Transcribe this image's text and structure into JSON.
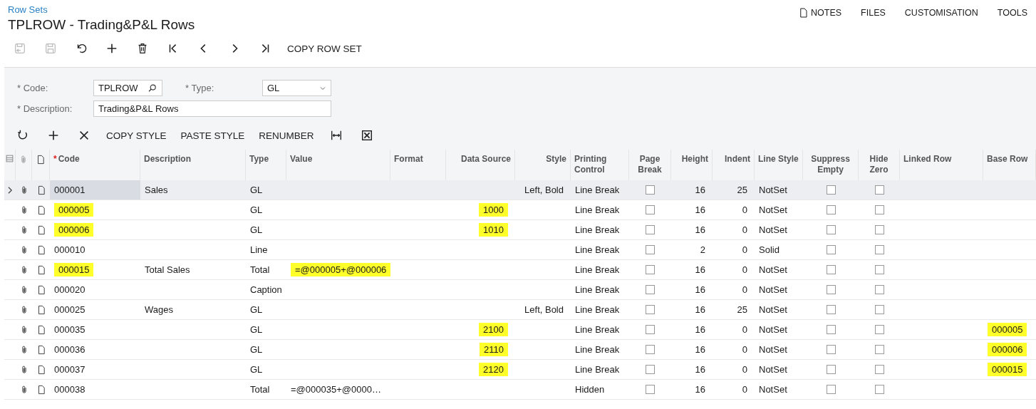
{
  "breadcrumb": "Row Sets",
  "title": "TPLROW - Trading&P&L Rows",
  "top_links": [
    {
      "kind": "note",
      "label": "NOTES"
    },
    {
      "kind": "plain",
      "label": "FILES"
    },
    {
      "kind": "plain",
      "label": "CUSTOMISATION"
    },
    {
      "kind": "plain",
      "label": "TOOLS"
    }
  ],
  "toolbar": [
    {
      "kind": "save-close",
      "disabled": true
    },
    {
      "kind": "save",
      "disabled": true
    },
    {
      "kind": "undo",
      "disabled": false
    },
    {
      "kind": "add",
      "disabled": false
    },
    {
      "kind": "delete",
      "disabled": false
    },
    {
      "kind": "first",
      "disabled": false
    },
    {
      "kind": "prev",
      "disabled": false
    },
    {
      "kind": "next",
      "disabled": false
    },
    {
      "kind": "last",
      "disabled": false
    },
    {
      "kind": "text",
      "label": "COPY ROW SET",
      "disabled": false
    }
  ],
  "form": {
    "code": {
      "mark": "*",
      "label": "Code:",
      "value": "TPLROW"
    },
    "type": {
      "mark": "*",
      "label": "Type:",
      "value": "GL"
    },
    "description": {
      "mark": "*",
      "label": "Description:",
      "value": "Trading&P&L Rows"
    }
  },
  "grid_toolbar": [
    {
      "kind": "refresh"
    },
    {
      "kind": "add"
    },
    {
      "kind": "remove"
    },
    {
      "kind": "text",
      "label": "COPY STYLE"
    },
    {
      "kind": "text",
      "label": "PASTE STYLE"
    },
    {
      "kind": "text",
      "label": "RENUMBER"
    },
    {
      "kind": "fit"
    },
    {
      "kind": "excel"
    }
  ],
  "columns": [
    {
      "label": "Code",
      "mark": "*"
    },
    {
      "label": "Description"
    },
    {
      "label": "Type"
    },
    {
      "label": "Value"
    },
    {
      "label": "Format"
    },
    {
      "label": "Data Source"
    },
    {
      "label": "Style"
    },
    {
      "label": "Printing Control"
    },
    {
      "label": "Page Break"
    },
    {
      "label": "Height"
    },
    {
      "label": "Indent"
    },
    {
      "label": "Line Style"
    },
    {
      "label": "Suppress Empty"
    },
    {
      "label": "Hide Zero"
    },
    {
      "label": "Linked Row"
    },
    {
      "label": "Base Row"
    }
  ],
  "rows": [
    {
      "selected": true,
      "cells": [
        {
          "text": "000001"
        },
        {
          "text": "Sales"
        },
        {
          "text": "GL"
        },
        null,
        null,
        null,
        {
          "text": "Left, Bold"
        },
        {
          "text": "Line Break"
        },
        {
          "checked": false
        },
        {
          "text": "16"
        },
        {
          "text": "25"
        },
        {
          "text": "NotSet"
        },
        {
          "checked": false
        },
        {
          "checked": false
        },
        null,
        null
      ]
    },
    {
      "selected": false,
      "cells": [
        {
          "text": "000005",
          "highlighted": true
        },
        null,
        {
          "text": "GL"
        },
        null,
        null,
        {
          "text": "1000",
          "highlighted": true
        },
        null,
        {
          "text": "Line Break"
        },
        {
          "checked": false
        },
        {
          "text": "16"
        },
        {
          "text": "0"
        },
        {
          "text": "NotSet"
        },
        {
          "checked": false
        },
        {
          "checked": false
        },
        null,
        null
      ]
    },
    {
      "selected": false,
      "cells": [
        {
          "text": "000006",
          "highlighted": true
        },
        null,
        {
          "text": "GL"
        },
        null,
        null,
        {
          "text": "1010",
          "highlighted": true
        },
        null,
        {
          "text": "Line Break"
        },
        {
          "checked": false
        },
        {
          "text": "16"
        },
        {
          "text": "0"
        },
        {
          "text": "NotSet"
        },
        {
          "checked": false
        },
        {
          "checked": false
        },
        null,
        null
      ]
    },
    {
      "selected": false,
      "cells": [
        {
          "text": "000010"
        },
        null,
        {
          "text": "Line"
        },
        null,
        null,
        null,
        null,
        {
          "text": "Line Break"
        },
        {
          "checked": false
        },
        {
          "text": "2"
        },
        {
          "text": "0"
        },
        {
          "text": "Solid"
        },
        {
          "checked": false
        },
        {
          "checked": false
        },
        null,
        null
      ]
    },
    {
      "selected": false,
      "cells": [
        {
          "text": "000015",
          "highlighted": true
        },
        {
          "text": "Total Sales"
        },
        {
          "text": "Total"
        },
        {
          "text": "=@000005+@000006",
          "highlighted": true
        },
        null,
        null,
        null,
        {
          "text": "Line Break"
        },
        {
          "checked": false
        },
        {
          "text": "16"
        },
        {
          "text": "0"
        },
        {
          "text": "NotSet"
        },
        {
          "checked": false
        },
        {
          "checked": false
        },
        null,
        null
      ]
    },
    {
      "selected": false,
      "cells": [
        {
          "text": "000020"
        },
        null,
        {
          "text": "Caption"
        },
        null,
        null,
        null,
        null,
        {
          "text": "Line Break"
        },
        {
          "checked": false
        },
        {
          "text": "16"
        },
        {
          "text": "0"
        },
        {
          "text": "NotSet"
        },
        {
          "checked": false
        },
        {
          "checked": false
        },
        null,
        null
      ]
    },
    {
      "selected": false,
      "cells": [
        {
          "text": "000025"
        },
        {
          "text": "Wages"
        },
        {
          "text": "GL"
        },
        null,
        null,
        null,
        {
          "text": "Left, Bold"
        },
        {
          "text": "Line Break"
        },
        {
          "checked": false
        },
        {
          "text": "16"
        },
        {
          "text": "25"
        },
        {
          "text": "NotSet"
        },
        {
          "checked": false
        },
        {
          "checked": false
        },
        null,
        null
      ]
    },
    {
      "selected": false,
      "cells": [
        {
          "text": "000035"
        },
        null,
        {
          "text": "GL"
        },
        null,
        null,
        {
          "text": "2100",
          "highlighted": true
        },
        null,
        {
          "text": "Line Break"
        },
        {
          "checked": false
        },
        {
          "text": "16"
        },
        {
          "text": "0"
        },
        {
          "text": "NotSet"
        },
        {
          "checked": false
        },
        {
          "checked": false
        },
        null,
        {
          "text": "000005",
          "highlighted": true
        }
      ]
    },
    {
      "selected": false,
      "cells": [
        {
          "text": "000036"
        },
        null,
        {
          "text": "GL"
        },
        null,
        null,
        {
          "text": "2110",
          "highlighted": true
        },
        null,
        {
          "text": "Line Break"
        },
        {
          "checked": false
        },
        {
          "text": "16"
        },
        {
          "text": "0"
        },
        {
          "text": "NotSet"
        },
        {
          "checked": false
        },
        {
          "checked": false
        },
        null,
        {
          "text": "000006",
          "highlighted": true
        }
      ]
    },
    {
      "selected": false,
      "cells": [
        {
          "text": "000037"
        },
        null,
        {
          "text": "GL"
        },
        null,
        null,
        {
          "text": "2120",
          "highlighted": true
        },
        null,
        {
          "text": "Line Break"
        },
        {
          "checked": false
        },
        {
          "text": "16"
        },
        {
          "text": "0"
        },
        {
          "text": "NotSet"
        },
        {
          "checked": false
        },
        {
          "checked": false
        },
        null,
        {
          "text": "000015",
          "highlighted": true
        }
      ]
    },
    {
      "selected": false,
      "cells": [
        {
          "text": "000038"
        },
        null,
        {
          "text": "Total"
        },
        {
          "text": "=@000035+@0000…"
        },
        null,
        null,
        null,
        {
          "text": "Hidden"
        },
        {
          "checked": false
        },
        {
          "text": "16"
        },
        {
          "text": "0"
        },
        {
          "text": "NotSet"
        },
        {
          "checked": false
        },
        {
          "checked": false
        },
        null,
        null
      ]
    }
  ]
}
